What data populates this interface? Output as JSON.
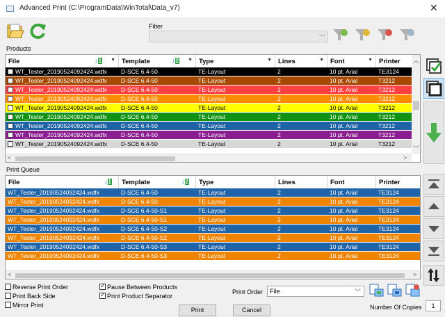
{
  "window": {
    "title": "Advanced Print (C:\\ProgramData\\WinTotal\\Data_v7)",
    "close": "✕"
  },
  "filter": {
    "label": "Filter",
    "value": ""
  },
  "products": {
    "label": "Products",
    "columns": [
      "File",
      "Template",
      "Type",
      "Lines",
      "Font",
      "Printer"
    ],
    "sort": {
      "file": "1",
      "template": "2"
    },
    "rows": [
      {
        "file": "WT_Tester_20190524092424.wdfx",
        "template": "D-SCE 6.4-50",
        "type": "TE-Layout",
        "lines": "2",
        "font": "10 pt. Arial",
        "printer": "TE3124",
        "bg": "#000000",
        "fg": "#ffffff"
      },
      {
        "file": "WT_Tester_20190524092424.wdfx",
        "template": "D-SCE 6.4-50",
        "type": "TE-Layout",
        "lines": "2",
        "font": "10 pt. Arial",
        "printer": "T3212",
        "bg": "#a54a00",
        "fg": "#ffffff"
      },
      {
        "file": "WT_Tester_20190524092424.wdfx",
        "template": "D-SCE 6.4-50",
        "type": "TE-Layout",
        "lines": "2",
        "font": "10 pt. Arial",
        "printer": "T3212",
        "bg": "#ff4040",
        "fg": "#ffffff"
      },
      {
        "file": "WT_Tester_20190524092424.wdfx",
        "template": "D-SCE 6.4-50",
        "type": "TE-Layout",
        "lines": "2",
        "font": "10 pt. Arial",
        "printer": "T3212",
        "bg": "#ff8c00",
        "fg": "#ffffff"
      },
      {
        "file": "WT_Tester_20190524092424.wdfx",
        "template": "D-SCE 6.4-50",
        "type": "TE-Layout",
        "lines": "2",
        "font": "10 pt. Arial",
        "printer": "T3212",
        "bg": "#ffff00",
        "fg": "#000000"
      },
      {
        "file": "WT_Tester_20190524092424.wdfx",
        "template": "D-SCE 6.4-50",
        "type": "TE-Layout",
        "lines": "2",
        "font": "10 pt. Arial",
        "printer": "T3212",
        "bg": "#129212",
        "fg": "#ffffff"
      },
      {
        "file": "WT_Tester_20190524092424.wdfx",
        "template": "D-SCE 6.4-50",
        "type": "TE-Layout",
        "lines": "2",
        "font": "10 pt. Arial",
        "printer": "T3212",
        "bg": "#1d63a6",
        "fg": "#ffffff"
      },
      {
        "file": "WT_Tester_20190524092424.wdfx",
        "template": "D-SCE 6.4-50",
        "type": "TE-Layout",
        "lines": "2",
        "font": "10 pt. Arial",
        "printer": "T3212",
        "bg": "#8a1d8f",
        "fg": "#ffffff"
      },
      {
        "file": "WT_Tester_20190524092424.wdfx",
        "template": "D-SCE 6.4-50",
        "type": "TE-Layout",
        "lines": "2",
        "font": "10 pt. Arial",
        "printer": "T3212",
        "bg": "#d8d8d8",
        "fg": "#000000"
      }
    ]
  },
  "queue": {
    "label": "Print Queue",
    "columns": [
      "File",
      "Template",
      "Type",
      "Lines",
      "Font",
      "Printer"
    ],
    "sort": {
      "file": "1",
      "template": "2"
    },
    "rows": [
      {
        "file": "WT_Tester_20190524092424.wdfx",
        "template": "D-SCE 6.4-50",
        "type": "TE-Layout",
        "lines": "2",
        "font": "10 pt. Arial",
        "printer": "TE3124",
        "bg": "#1f64a8",
        "fg": "#ffffff"
      },
      {
        "file": "WT_Tester_20190524092424.wdfx",
        "template": "D-SCE 6.4-50",
        "type": "TE-Layout",
        "lines": "2",
        "font": "10 pt. Arial",
        "printer": "TE3124",
        "bg": "#ee8400",
        "fg": "#ffffff"
      },
      {
        "file": "WT_Tester_20190524092424.wdfx",
        "template": "D-SCE 6.4-50-S1",
        "type": "TE-Layout",
        "lines": "2",
        "font": "10 pt. Arial",
        "printer": "TE3124",
        "bg": "#1f64a8",
        "fg": "#ffffff"
      },
      {
        "file": "WT_Tester_20190524092424.wdfx",
        "template": "D-SCE 6.4-50-S1",
        "type": "TE-Layout",
        "lines": "2",
        "font": "10 pt. Arial",
        "printer": "TE3124",
        "bg": "#ee8400",
        "fg": "#ffffff"
      },
      {
        "file": "WT_Tester_20190524092424.wdfx",
        "template": "D-SCE 6.4-50-S2",
        "type": "TE-Layout",
        "lines": "2",
        "font": "10 pt. Arial",
        "printer": "TE3124",
        "bg": "#1f64a8",
        "fg": "#ffffff"
      },
      {
        "file": "WT_Tester_20190524092424.wdfx",
        "template": "D-SCE 6.4-50-S2",
        "type": "TE-Layout",
        "lines": "2",
        "font": "10 pt. Arial",
        "printer": "TE3124",
        "bg": "#ee8400",
        "fg": "#ffffff"
      },
      {
        "file": "WT_Tester_20190524092424.wdfx",
        "template": "D-SCE 6.4-50-S3",
        "type": "TE-Layout",
        "lines": "2",
        "font": "10 pt. Arial",
        "printer": "TE3124",
        "bg": "#1f64a8",
        "fg": "#ffffff"
      },
      {
        "file": "WT_Tester_20190524092424.wdfx",
        "template": "D-SCE 6.4-50-S3",
        "type": "TE-Layout",
        "lines": "2",
        "font": "10 pt. Arial",
        "printer": "TE3124",
        "bg": "#ee8400",
        "fg": "#ffffff"
      }
    ]
  },
  "options": {
    "reverse_print_order": {
      "label": "Reverse Print Order",
      "checked": false
    },
    "print_back_side": {
      "label": "Print Back Side",
      "checked": false
    },
    "mirror_print": {
      "label": "Mirror Print",
      "checked": false
    },
    "pause_between_products": {
      "label": "Pause Between Products",
      "checked": true
    },
    "print_product_separator": {
      "label": "Print Product Separator",
      "checked": true
    }
  },
  "print_order": {
    "label": "Print Order",
    "value": "File"
  },
  "copies": {
    "label": "Number Of Copies",
    "value": "1"
  },
  "buttons": {
    "print": "Print",
    "cancel": "Cancel"
  },
  "icons": {
    "open": "folder-open-icon",
    "refresh": "refresh-icon",
    "filter_apply": "filter-check-icon",
    "filter_add": "filter-add-icon",
    "filter_remove": "filter-remove-icon",
    "filter_edit": "filter-edit-icon",
    "add_all": "add-all-icon",
    "add_selected": "add-selected-icon",
    "move_down": "arrow-down-icon",
    "move_top": "move-top-icon",
    "move_up": "move-up-icon",
    "move_down_q": "move-down-icon",
    "move_bottom": "move-bottom-icon",
    "swap": "sort-swap-icon",
    "print_setup_1": "print-setup-icon",
    "print_setup_2": "print-preview-icon",
    "print_setup_3": "print-delete-icon"
  },
  "colors": {
    "accent_green": "#4caf50",
    "filter_gold": "#c9a227",
    "select_blue": "#1f64a8"
  }
}
